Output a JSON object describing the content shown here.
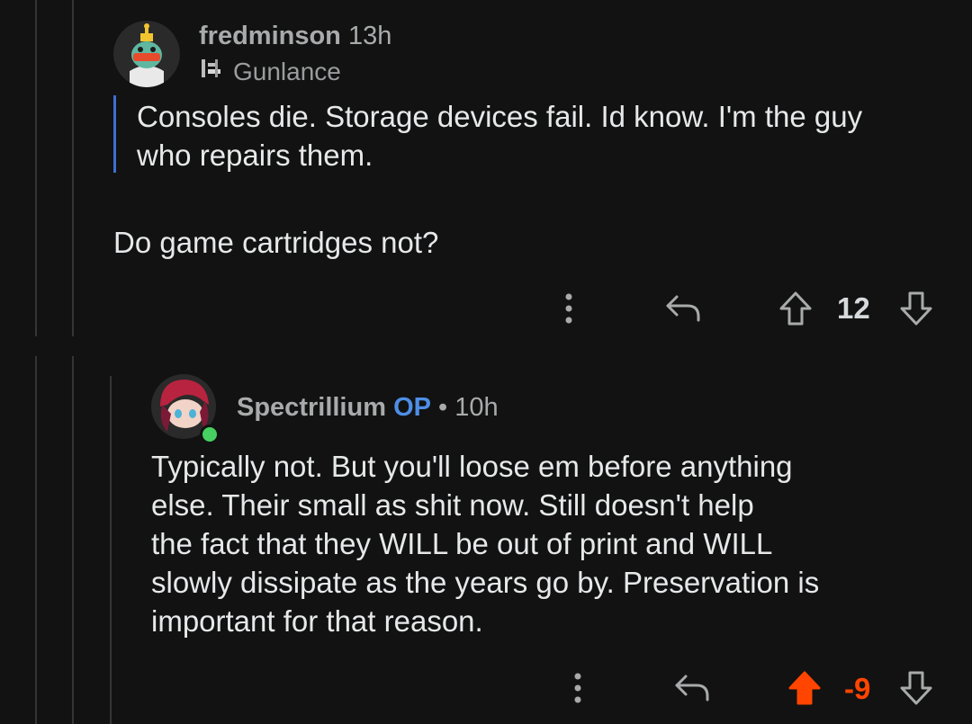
{
  "comments": [
    {
      "username": "fredminson",
      "time": "13h",
      "flair": "Gunlance",
      "quote": "Consoles die. Storage devices fail. Id know. I'm the guy who repairs them.",
      "text": "Do game cartridges not?",
      "score": "12",
      "vote_state": "none"
    },
    {
      "username": "Spectrillium",
      "op_badge": "OP",
      "separator": "•",
      "time": "10h",
      "text_lines": [
        "Typically not. But you'll loose em before anything",
        "else. Their small as shit now. Still doesn't help",
        "the fact that they WILL be out of print and WILL",
        "slowly dissipate as the years go by. Preservation is",
        "important for that reason."
      ],
      "score": "-9",
      "vote_state": "upvoted",
      "online": true
    }
  ],
  "colors": {
    "background": "#121212",
    "thread_line": "#343536",
    "quote_bar": "#3d6fd6",
    "op_badge": "#4e8ee6",
    "upvote_active": "#ff4500",
    "icon": "#a8aaab",
    "online": "#46d160"
  },
  "icons": [
    "more-options-icon",
    "reply-icon",
    "upvote-arrow-icon",
    "downvote-arrow-icon"
  ]
}
